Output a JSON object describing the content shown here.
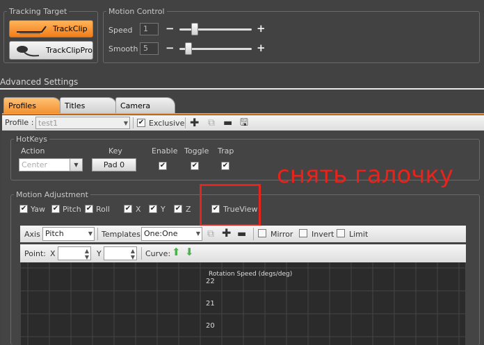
{
  "tracking_target": {
    "title": "Tracking Target",
    "trackclip_label": "TrackClip",
    "trackclippro_label": "TrackClipPro"
  },
  "motion_control": {
    "title": "Motion Control",
    "speed_label": "Speed",
    "speed_value": "1",
    "smooth_label": "Smooth",
    "smooth_value": "5",
    "minus": "−",
    "plus": "+"
  },
  "advanced_settings": {
    "title": "Advanced Settings"
  },
  "tabs": [
    {
      "label": "Profiles",
      "active": true
    },
    {
      "label": "Titles",
      "active": false
    },
    {
      "label": "Camera",
      "active": false
    }
  ],
  "profile_bar": {
    "profile_label": "Profile :",
    "profile_value": "test1",
    "exclusive_label": "Exclusive"
  },
  "hotkeys": {
    "title": "HotKeys",
    "action_header": "Action",
    "key_header": "Key",
    "enable_header": "Enable",
    "toggle_header": "Toggle",
    "trap_header": "Trap",
    "action_value": "Center",
    "key_value": "Pad 0"
  },
  "annotation": {
    "text": "снять галочку",
    "color": "#e8231c"
  },
  "motion_adjustment": {
    "title": "Motion Adjustment",
    "axes": [
      "Yaw",
      "Pitch",
      "Roll",
      "X",
      "Y",
      "Z"
    ],
    "trueview_label": "TrueView"
  },
  "curve_toolbar": {
    "axis_label": "Axis",
    "axis_value": "Pitch",
    "templates_label": "Templates",
    "templates_value": "One:One",
    "mirror_label": "Mirror",
    "invert_label": "Invert",
    "limit_label": "Limit",
    "point_label": "Point:",
    "x_label": "X",
    "y_label": "Y",
    "curve_label": "Curve:"
  },
  "chart": {
    "title": "Rotation Speed (degs/deg)",
    "ticks": [
      "22",
      "21",
      "20"
    ]
  }
}
